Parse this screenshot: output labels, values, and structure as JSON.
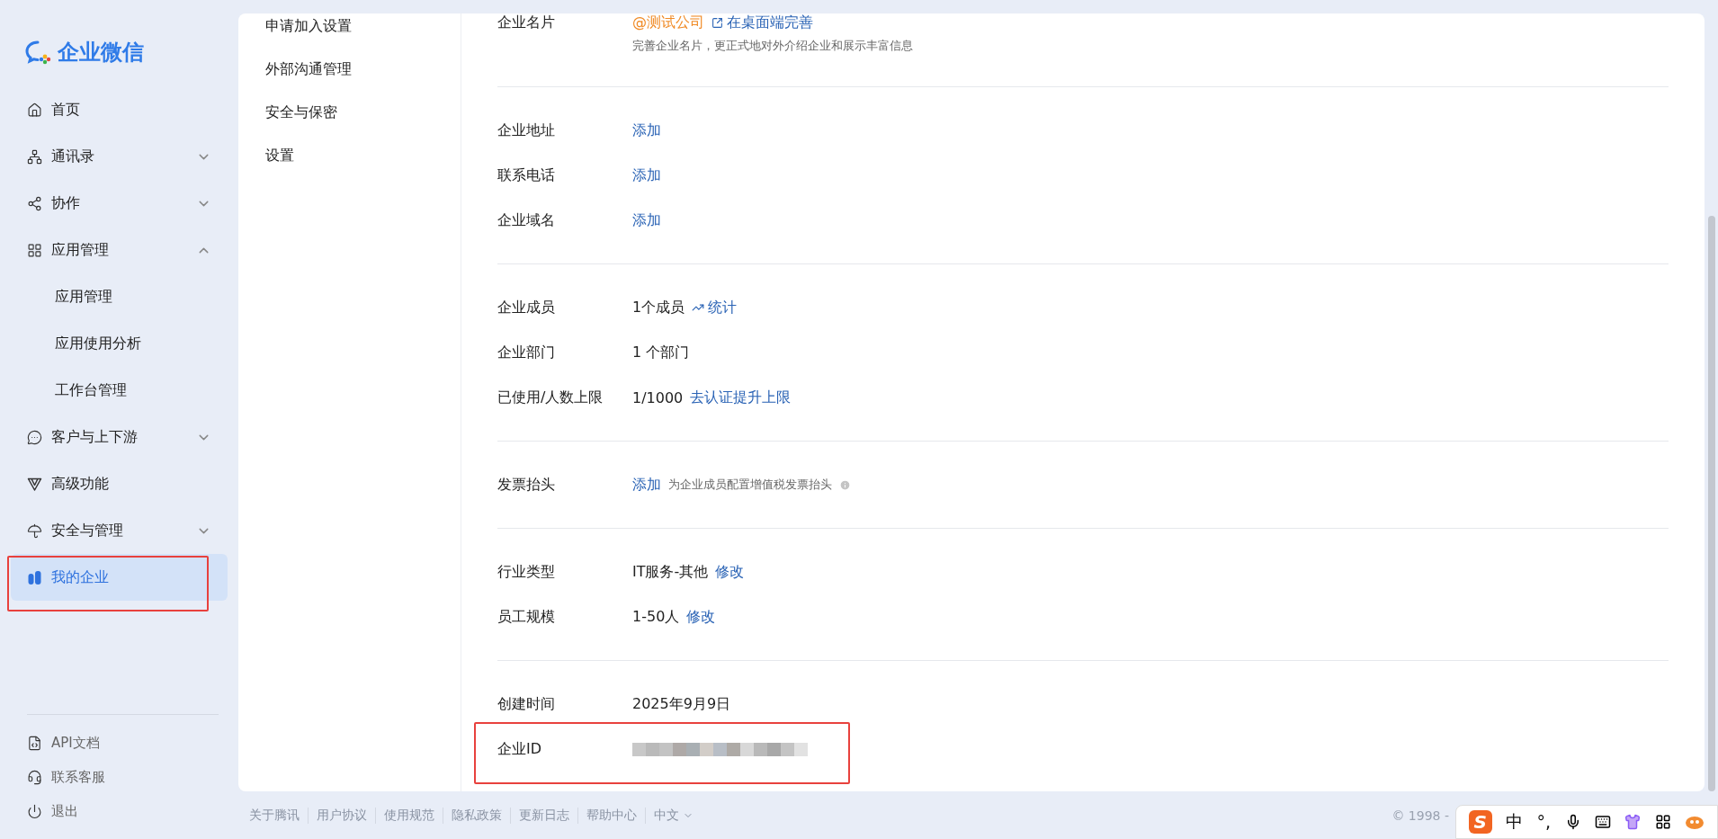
{
  "sidebar": {
    "logo": "企业微信",
    "items": [
      {
        "label": "首页",
        "kind": "link",
        "selected": false
      },
      {
        "label": "通讯录",
        "kind": "group",
        "expanded": false,
        "selected": false
      },
      {
        "label": "协作",
        "kind": "group",
        "expanded": false,
        "selected": false
      },
      {
        "label": "应用管理",
        "kind": "group",
        "expanded": true,
        "selected": false,
        "children": [
          {
            "label": "应用管理",
            "selected": false
          },
          {
            "label": "应用使用分析",
            "selected": false
          },
          {
            "label": "工作台管理",
            "selected": false
          }
        ]
      },
      {
        "label": "客户与上下游",
        "kind": "group",
        "expanded": false,
        "selected": false
      },
      {
        "label": "高级功能",
        "kind": "link",
        "selected": false
      },
      {
        "label": "安全与管理",
        "kind": "group",
        "expanded": false,
        "selected": false
      },
      {
        "label": "我的企业",
        "kind": "link",
        "selected": true,
        "highlighted": true
      }
    ],
    "bottom_items": [
      "API文档",
      "联系客服",
      "退出"
    ]
  },
  "sub_nav": [
    {
      "label": "申请加入设置",
      "selected": false
    },
    {
      "label": "外部沟通管理",
      "selected": false
    },
    {
      "label": "安全与保密",
      "selected": false
    },
    {
      "label": "设置",
      "selected": false
    }
  ],
  "sections": [
    {
      "rows": [
        {
          "label": "企业名片",
          "parts": [
            {
              "kind": "accent",
              "text": "@测试公司"
            },
            {
              "kind": "desktoplink",
              "text": "在桌面端完善"
            }
          ],
          "hint": "完善企业名片，更正式地对外介绍企业和展示丰富信息"
        }
      ]
    },
    {
      "rows": [
        {
          "label": "企业地址",
          "parts": [
            {
              "kind": "link",
              "text": "添加"
            }
          ]
        },
        {
          "label": "联系电话",
          "parts": [
            {
              "kind": "link",
              "text": "添加"
            }
          ]
        },
        {
          "label": "企业域名",
          "parts": [
            {
              "kind": "link",
              "text": "添加"
            }
          ]
        }
      ]
    },
    {
      "rows": [
        {
          "label": "企业成员",
          "parts": [
            {
              "kind": "text",
              "text": "1个成员"
            },
            {
              "kind": "statslink",
              "text": "统计"
            }
          ]
        },
        {
          "label": "企业部门",
          "parts": [
            {
              "kind": "text",
              "text": "1 个部门"
            }
          ]
        },
        {
          "label": "已使用/人数上限",
          "parts": [
            {
              "kind": "text",
              "text": "1/1000"
            },
            {
              "kind": "link",
              "text": "去认证提升上限"
            }
          ]
        }
      ]
    },
    {
      "rows": [
        {
          "label": "发票抬头",
          "parts": [
            {
              "kind": "link",
              "text": "添加"
            },
            {
              "kind": "note",
              "text": "为企业成员配置增值税发票抬头"
            }
          ]
        }
      ]
    },
    {
      "rows": [
        {
          "label": "行业类型",
          "parts": [
            {
              "kind": "text",
              "text": "IT服务-其他"
            },
            {
              "kind": "link",
              "text": "修改"
            }
          ]
        },
        {
          "label": "员工规模",
          "parts": [
            {
              "kind": "text",
              "text": "1-50人"
            },
            {
              "kind": "link",
              "text": "修改"
            }
          ]
        }
      ]
    },
    {
      "rows": [
        {
          "label": "创建时间",
          "parts": [
            {
              "kind": "text",
              "text": "2025年9月9日"
            }
          ]
        },
        {
          "label": "企业ID",
          "parts": [
            {
              "kind": "masked"
            }
          ],
          "highlighted": true
        }
      ]
    }
  ],
  "footer": {
    "links": [
      {
        "label": "关于腾讯",
        "kind": "link"
      },
      {
        "label": "用户协议",
        "kind": "link"
      },
      {
        "label": "使用规范",
        "kind": "link"
      },
      {
        "label": "隐私政策",
        "kind": "link"
      },
      {
        "label": "更新日志",
        "kind": "link"
      },
      {
        "label": "帮助中心",
        "kind": "link"
      },
      {
        "label": "中文",
        "kind": "language"
      }
    ],
    "copyright": "© 1998 -"
  },
  "ime_toolbar": {
    "logo": "S",
    "mode": "中",
    "punctuation": "°,"
  }
}
